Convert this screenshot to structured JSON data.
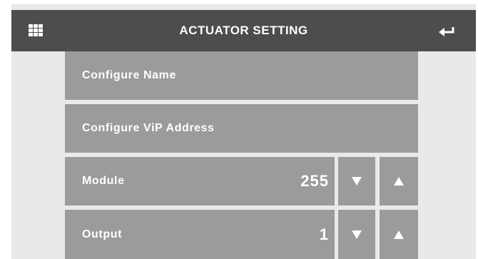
{
  "header": {
    "title": "ACTUATOR SETTING",
    "menu_icon": "grid-menu-icon",
    "back_icon": "enter-return-icon"
  },
  "menu": {
    "configure_name": "Configure Name",
    "configure_vip": "Configure ViP Address"
  },
  "module": {
    "label": "Module",
    "value": "255"
  },
  "output": {
    "label": "Output",
    "value": "1"
  },
  "colors": {
    "header_bg": "#4d4d4d",
    "tile_bg": "#9b9b9b",
    "screen_bg": "#e9e9e9",
    "text": "#ffffff"
  }
}
